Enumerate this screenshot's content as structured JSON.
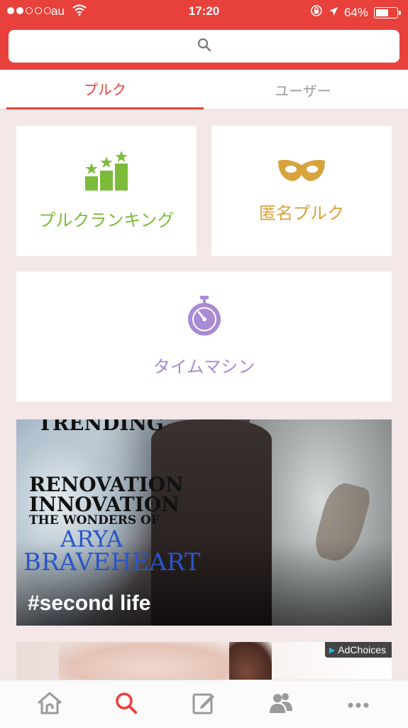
{
  "status_bar": {
    "carrier": "au",
    "time": "17:20",
    "battery": "64%",
    "battery_level": 0.64
  },
  "search": {
    "icon": "search-icon"
  },
  "tabs": [
    {
      "label": "プルク",
      "active": true
    },
    {
      "label": "ユーザー",
      "active": false
    }
  ],
  "cards": {
    "ranking": {
      "label": "プルクランキング",
      "icon": "ranking-stars-icon",
      "color": "#7dbb3a"
    },
    "anonymous": {
      "label": "匿名プルク",
      "icon": "mask-icon",
      "color": "#d7a33c"
    },
    "time_machine": {
      "label": "タイムマシン",
      "icon": "stopwatch-icon",
      "color": "#a98ad4"
    }
  },
  "banner": {
    "text_trending": "TRENDING",
    "text_line1": "RENOVATION",
    "text_line2": "INNOVATION",
    "text_line3": "THE WONDERS OF",
    "text_arya": "ARYA",
    "text_braveheart": "BRAVEHEART",
    "caption": "#second life"
  },
  "ad": {
    "adchoices_label": "AdChoices"
  },
  "bottom_nav": [
    {
      "name": "home",
      "icon": "home-icon"
    },
    {
      "name": "search",
      "icon": "search-icon",
      "active": true
    },
    {
      "name": "compose",
      "icon": "compose-icon"
    },
    {
      "name": "users",
      "icon": "users-icon"
    },
    {
      "name": "more",
      "icon": "more-icon"
    }
  ],
  "colors": {
    "accent": "#e8413c",
    "background": "#f3e7e7"
  }
}
